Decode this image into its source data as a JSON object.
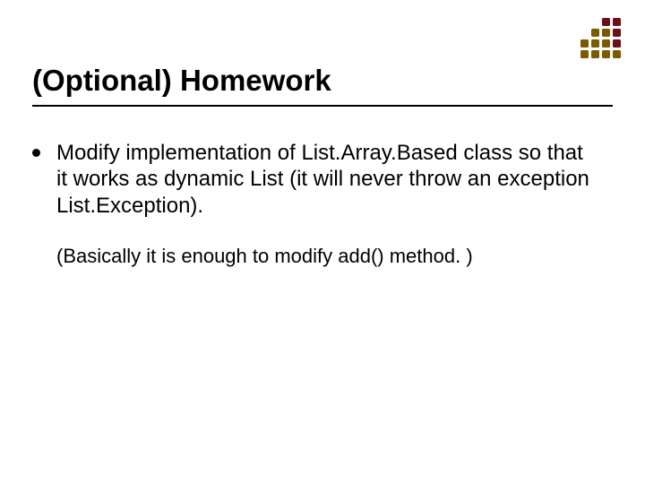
{
  "title": "(Optional) Homework",
  "body": {
    "items": [
      {
        "text": "Modify implementation of List.Array.Based class so that it works as dynamic List (it will never throw an exception List.Exception).",
        "sub": "(Basically it is enough to modify add() method. )"
      }
    ]
  },
  "decoration": {
    "pattern": [
      [
        "",
        "",
        "#6b0f1a",
        "#6b0f1a"
      ],
      [
        "",
        "#7a5b00",
        "#7a5b00",
        "#6b0f1a"
      ],
      [
        "#7a5b00",
        "#7a5b00",
        "#7a5b00",
        "#6b0f1a"
      ],
      [
        "#7a5b00",
        "#7a5b00",
        "#7a5b00",
        "#7a5b00"
      ]
    ]
  }
}
